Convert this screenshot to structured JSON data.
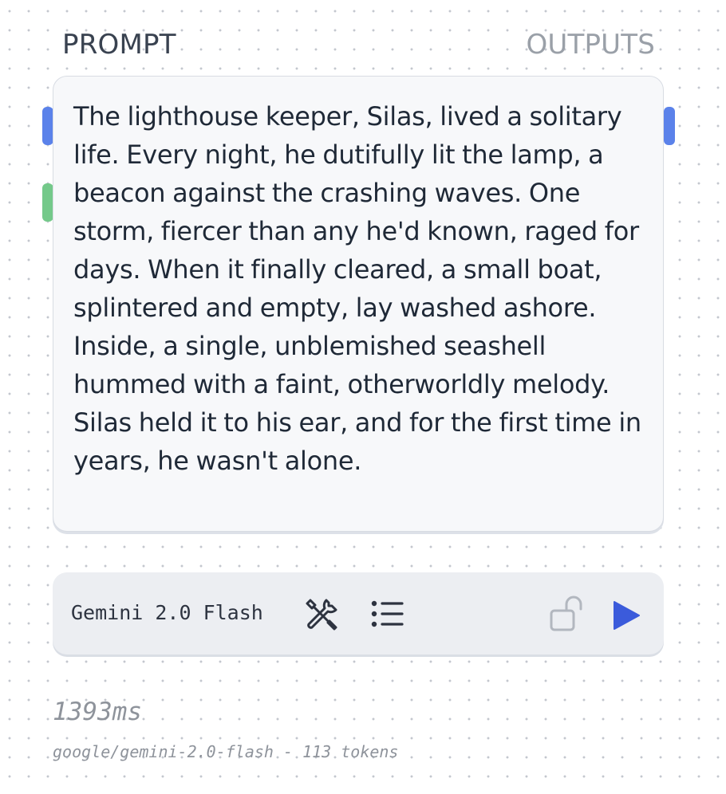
{
  "header": {
    "prompt_label": "PROMPT",
    "outputs_label": "OUTPUTS"
  },
  "prompt": {
    "text": "The lighthouse keeper, Silas, lived a solitary life. Every night, he dutifully lit the lamp, a beacon against the crashing waves. One storm, fiercer than any he'd known, raged for days. When it finally cleared, a small boat, splintered and empty, lay washed ashore. Inside, a single, unblemished seashell hummed with a faint, otherworldly melody. Silas held it to his ear, and for the first time in years, he wasn't alone."
  },
  "toolbar": {
    "model_name": "Gemini 2.0 Flash",
    "icons": [
      "tools-icon",
      "list-icon",
      "unlock-icon",
      "play-icon"
    ]
  },
  "result": {
    "duration": "1393ms",
    "meta": "google/gemini-2.0-flash - 113 tokens"
  },
  "colors": {
    "accent_blue": "#3b5bdb",
    "handle_blue": "#5b82ea",
    "handle_green": "#74c98a",
    "muted_text": "#8e939b"
  }
}
